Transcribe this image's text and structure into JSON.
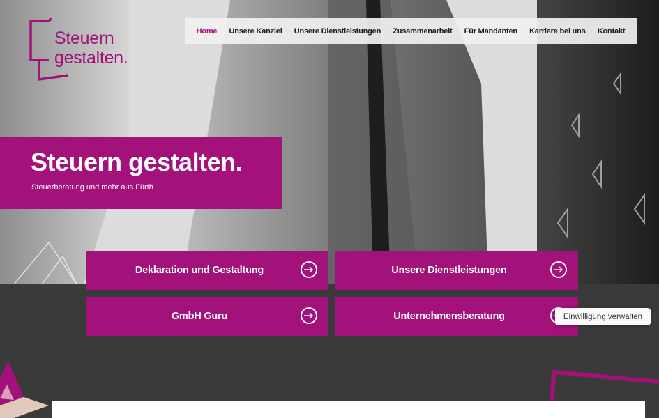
{
  "logo": {
    "line1": "Steuern",
    "line2": "gestalten."
  },
  "nav": {
    "items": [
      {
        "label": "Home",
        "active": true
      },
      {
        "label": "Unsere Kanzlei",
        "active": false
      },
      {
        "label": "Unsere Dienstleistungen",
        "active": false
      },
      {
        "label": "Zusammenarbeit",
        "active": false
      },
      {
        "label": "Für Mandanten",
        "active": false
      },
      {
        "label": "Karriere bei uns",
        "active": false
      },
      {
        "label": "Kontakt",
        "active": false
      }
    ]
  },
  "hero": {
    "title": "Steuern gestalten.",
    "subtitle": "Steuerberatung und mehr aus Fürth"
  },
  "tiles": [
    {
      "label": "Deklaration und Gestaltung"
    },
    {
      "label": "Unsere Dienstleistungen"
    },
    {
      "label": "GmbH Guru"
    },
    {
      "label": "Unternehmensberatung"
    }
  ],
  "consent": {
    "label": "Einwilligung verwalten"
  },
  "colors": {
    "brand": "#a3117a",
    "dark_bg": "#3a3a3a",
    "nav_bg": "#f0f0f0"
  }
}
